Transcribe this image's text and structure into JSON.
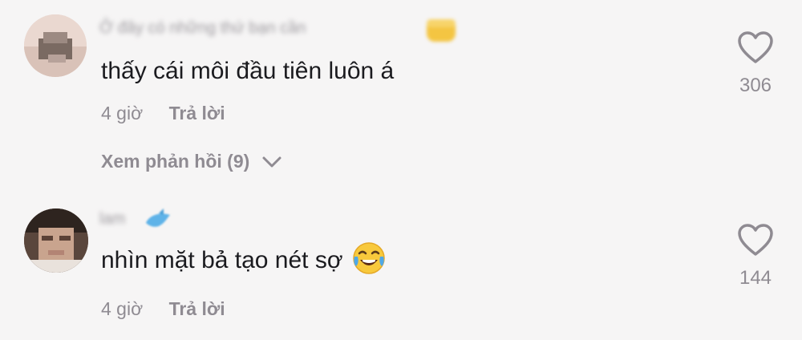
{
  "comments": [
    {
      "username": "Ở đây có những thứ bạn cần",
      "text": "thấy cái môi đầu tiên luôn á",
      "time": "4 giờ",
      "reply_label": "Trả lời",
      "view_replies_label": "Xem phản hồi (9)",
      "likes": "306"
    },
    {
      "username": "lam",
      "text": "nhìn mặt bả tạo nét sợ",
      "time": "4 giờ",
      "reply_label": "Trả lời",
      "likes": "144"
    }
  ],
  "icons": {
    "like": "heart-outline-icon",
    "expand": "chevron-down-icon",
    "emoji": "face-with-tears-of-joy-emoji"
  },
  "colors": {
    "background": "#f6f5f5",
    "text": "#1b1b1f",
    "secondary": "#8f8b92"
  }
}
